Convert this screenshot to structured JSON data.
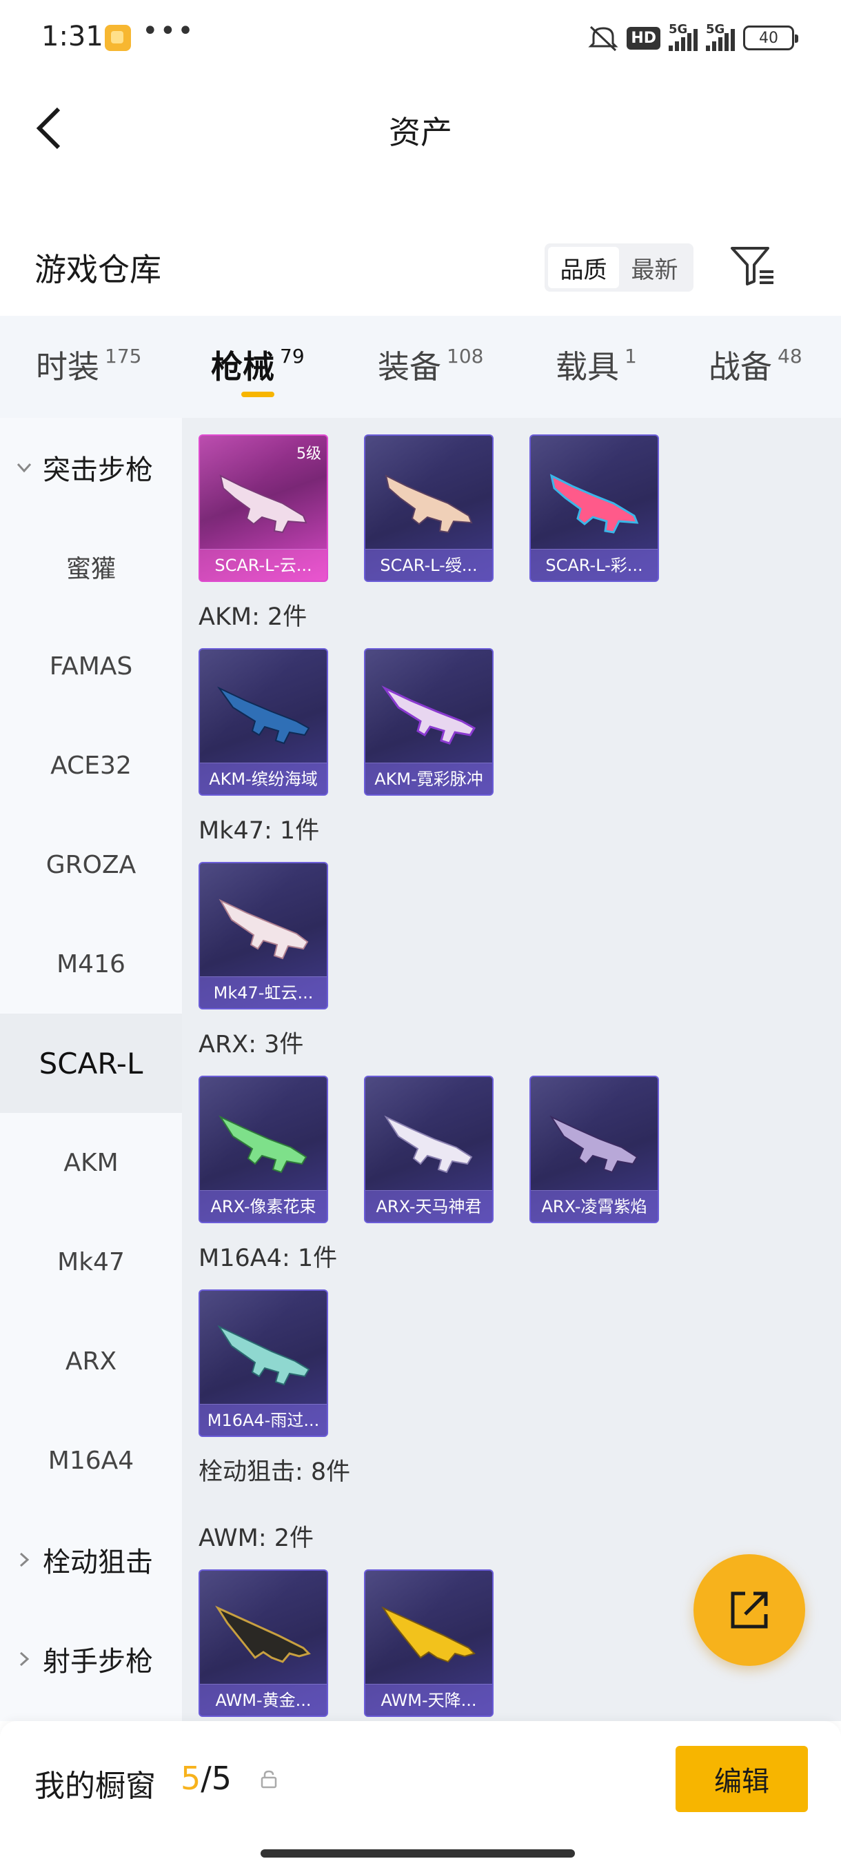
{
  "status_bar": {
    "time": "1:31",
    "more": "•••",
    "hd": "HD",
    "net1": "5G",
    "net2": "5G",
    "battery": "40"
  },
  "header": {
    "title": "资产"
  },
  "warehouse": {
    "title": "游戏仓库",
    "sort_quality": "品质",
    "sort_newest": "最新"
  },
  "tabs": [
    {
      "label": "时装",
      "count": "175"
    },
    {
      "label": "枪械",
      "count": "79"
    },
    {
      "label": "装备",
      "count": "108"
    },
    {
      "label": "载具",
      "count": "1"
    },
    {
      "label": "战备",
      "count": "48"
    }
  ],
  "sidebar": {
    "category_assault": "突击步枪",
    "items": [
      "蜜獾",
      "FAMAS",
      "ACE32",
      "GROZA",
      "M416",
      "SCAR-L",
      "AKM",
      "Mk47",
      "ARX",
      "M16A4"
    ],
    "category_sniper": "栓动狙击",
    "category_marksman": "射手步枪"
  },
  "content": {
    "groups": {
      "akm": "AKM: 2件",
      "mk47": "Mk47: 1件",
      "arx": "ARX: 3件",
      "m16a4": "M16A4: 1件",
      "bolt": "栓动狙击: 8件",
      "awm": "AWM: 2件"
    },
    "cards": [
      {
        "name": "SCAR-L-云...",
        "level": "5级"
      },
      {
        "name": "SCAR-L-绶..."
      },
      {
        "name": "SCAR-L-彩..."
      },
      {
        "name": "AKM-缤纷海域"
      },
      {
        "name": "AKM-霓彩脉冲"
      },
      {
        "name": "Mk47-虹云..."
      },
      {
        "name": "ARX-像素花束"
      },
      {
        "name": "ARX-天马神君"
      },
      {
        "name": "ARX-凌霄紫焰"
      },
      {
        "name": "M16A4-雨过..."
      },
      {
        "name": "AWM-黄金..."
      },
      {
        "name": "AWM-天降..."
      }
    ]
  },
  "bottom_bar": {
    "showcase_label": "我的橱窗",
    "showcase_current": "5",
    "showcase_total": "/5",
    "edit_label": "编辑"
  },
  "colors": {
    "accent": "#f7b500",
    "card_border": "#6b5dd8",
    "card_pink": "#e04ad0"
  }
}
